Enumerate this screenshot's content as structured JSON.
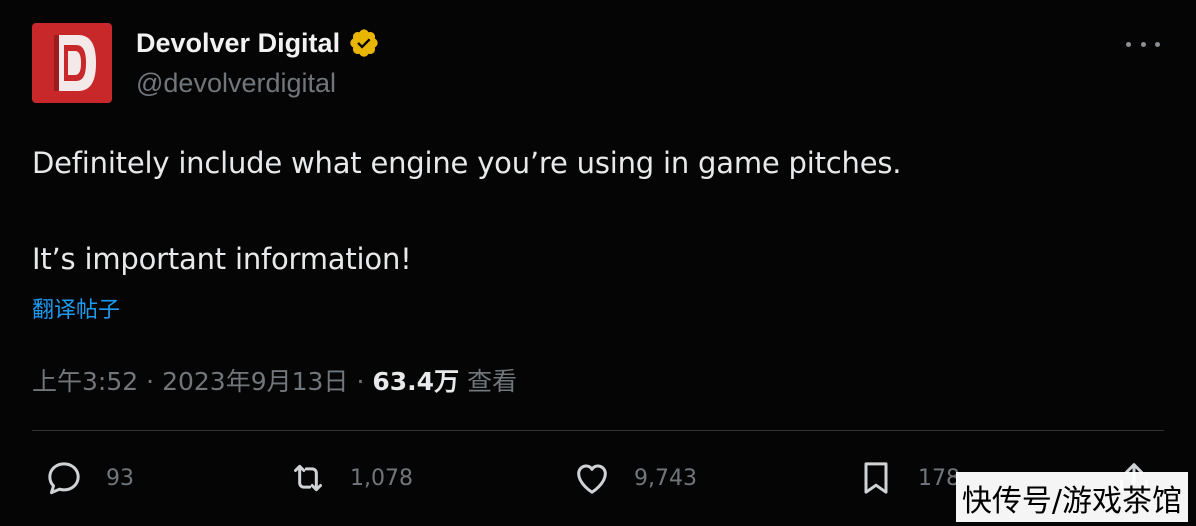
{
  "author": {
    "name": "Devolver Digital",
    "handle": "@devolverdigital",
    "verified": true,
    "avatar_color": "#c8282a",
    "avatar_letter": "D"
  },
  "tweet": {
    "line1": "Definitely include what engine you’re using in game pitches.",
    "line2": "It’s important information!",
    "translate_label": "翻译帖子"
  },
  "meta": {
    "time": "上午3:52",
    "separator": "·",
    "date": "2023年9月13日",
    "views": "63.4万",
    "views_label": "查看"
  },
  "actions": {
    "replies": "93",
    "retweets": "1,078",
    "likes": "9,743",
    "bookmarks": "178"
  },
  "colors": {
    "background": "#050505",
    "text": "#e7e9ea",
    "secondary": "#71767b",
    "link": "#1d9bf0",
    "verified_badge": "#e8b500"
  },
  "watermark": "快传号/游戏茶馆"
}
